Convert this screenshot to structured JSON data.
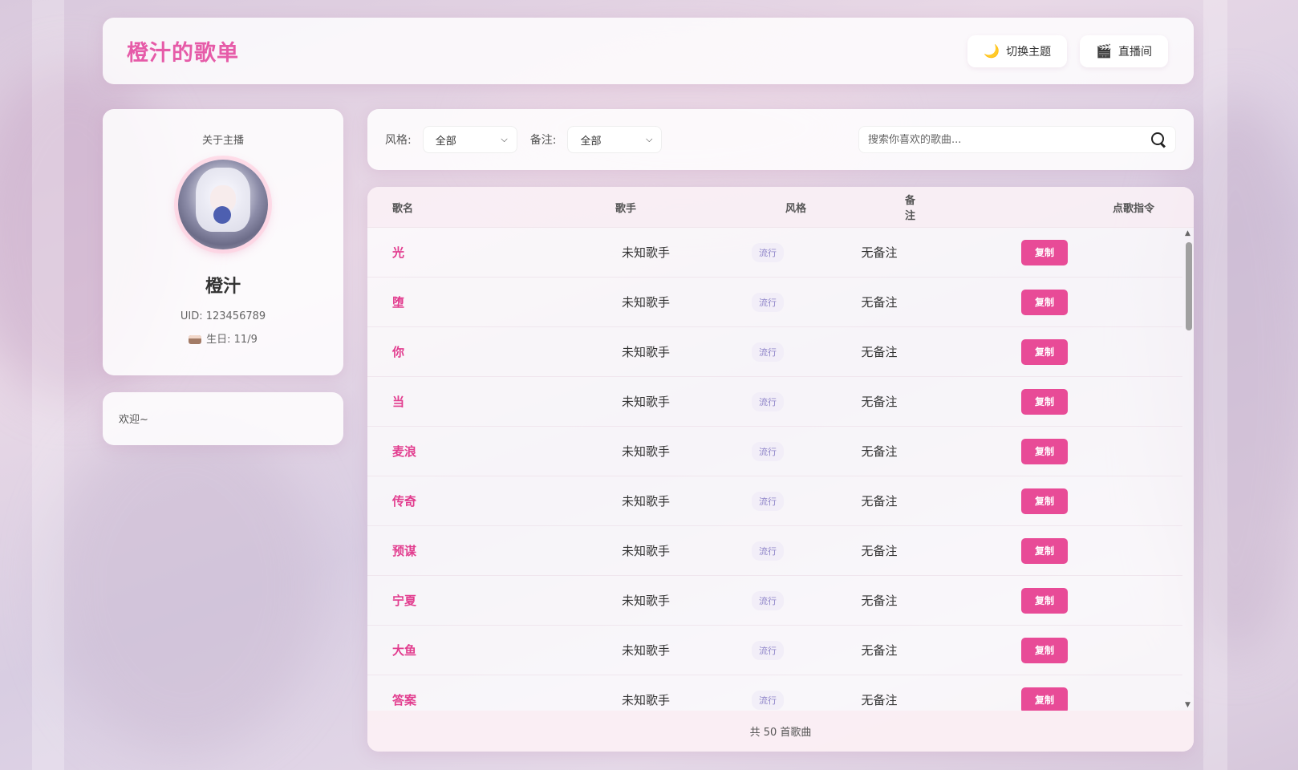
{
  "header": {
    "title": "橙汁的歌单",
    "theme_button": {
      "icon": "moon-icon",
      "label": "切换主题"
    },
    "live_button": {
      "icon": "clapper-icon",
      "label": "直播间"
    }
  },
  "profile": {
    "section_title": "关于主播",
    "name": "橙汁",
    "uid": "UID: 123456789",
    "birthday": "生日: 11/9"
  },
  "welcome": {
    "text": "欢迎~"
  },
  "filters": {
    "style_label": "风格:",
    "style_value": "全部",
    "note_label": "备注:",
    "note_value": "全部",
    "search_placeholder": "搜索你喜欢的歌曲..."
  },
  "table": {
    "columns": [
      "歌名",
      "歌手",
      "风格",
      "备注",
      "点歌指令"
    ],
    "rows": [
      {
        "song": "光",
        "singer": "未知歌手",
        "style": "流行",
        "note": "无备注",
        "action": "复制"
      },
      {
        "song": "堕",
        "singer": "未知歌手",
        "style": "流行",
        "note": "无备注",
        "action": "复制"
      },
      {
        "song": "你",
        "singer": "未知歌手",
        "style": "流行",
        "note": "无备注",
        "action": "复制"
      },
      {
        "song": "当",
        "singer": "未知歌手",
        "style": "流行",
        "note": "无备注",
        "action": "复制"
      },
      {
        "song": "麦浪",
        "singer": "未知歌手",
        "style": "流行",
        "note": "无备注",
        "action": "复制"
      },
      {
        "song": "传奇",
        "singer": "未知歌手",
        "style": "流行",
        "note": "无备注",
        "action": "复制"
      },
      {
        "song": "预谋",
        "singer": "未知歌手",
        "style": "流行",
        "note": "无备注",
        "action": "复制"
      },
      {
        "song": "宁夏",
        "singer": "未知歌手",
        "style": "流行",
        "note": "无备注",
        "action": "复制"
      },
      {
        "song": "大鱼",
        "singer": "未知歌手",
        "style": "流行",
        "note": "无备注",
        "action": "复制"
      },
      {
        "song": "答案",
        "singer": "未知歌手",
        "style": "流行",
        "note": "无备注",
        "action": "复制"
      }
    ],
    "footer": "共 50 首歌曲"
  },
  "colors": {
    "accent": "#e65ba8",
    "button": "#e84b97",
    "song_name": "#e23d8f",
    "tag": "#8e84c9"
  }
}
